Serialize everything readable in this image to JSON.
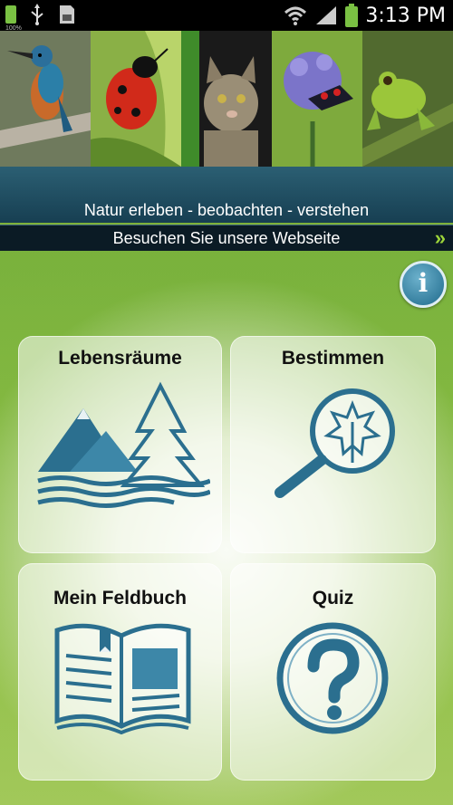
{
  "status_bar": {
    "battery_percent": "100%",
    "time": "3:13 PM"
  },
  "photos": [
    {
      "name": "kingfisher"
    },
    {
      "name": "ladybug"
    },
    {
      "name": "cat"
    },
    {
      "name": "moth-on-flower"
    },
    {
      "name": "frog"
    }
  ],
  "header": {
    "tagline": "Natur erleben - beobachten - verstehen",
    "visit_link": "Besuchen Sie unsere Webseite",
    "visit_arrow": "»"
  },
  "info_button": {
    "label": "i"
  },
  "tiles": {
    "habitats": {
      "label": "Lebensräume",
      "icon": "mountains-trees-icon"
    },
    "identify": {
      "label": "Bestimmen",
      "icon": "magnifier-leaf-icon"
    },
    "fieldbook": {
      "label": "Mein Feldbuch",
      "icon": "open-book-icon"
    },
    "quiz": {
      "label": "Quiz",
      "icon": "question-mark-icon"
    }
  },
  "colors": {
    "accent": "#2b6f8f",
    "header_band": "#1f4b5f",
    "background_green": "#7fb23a",
    "arrow_green": "#9cd43a"
  }
}
